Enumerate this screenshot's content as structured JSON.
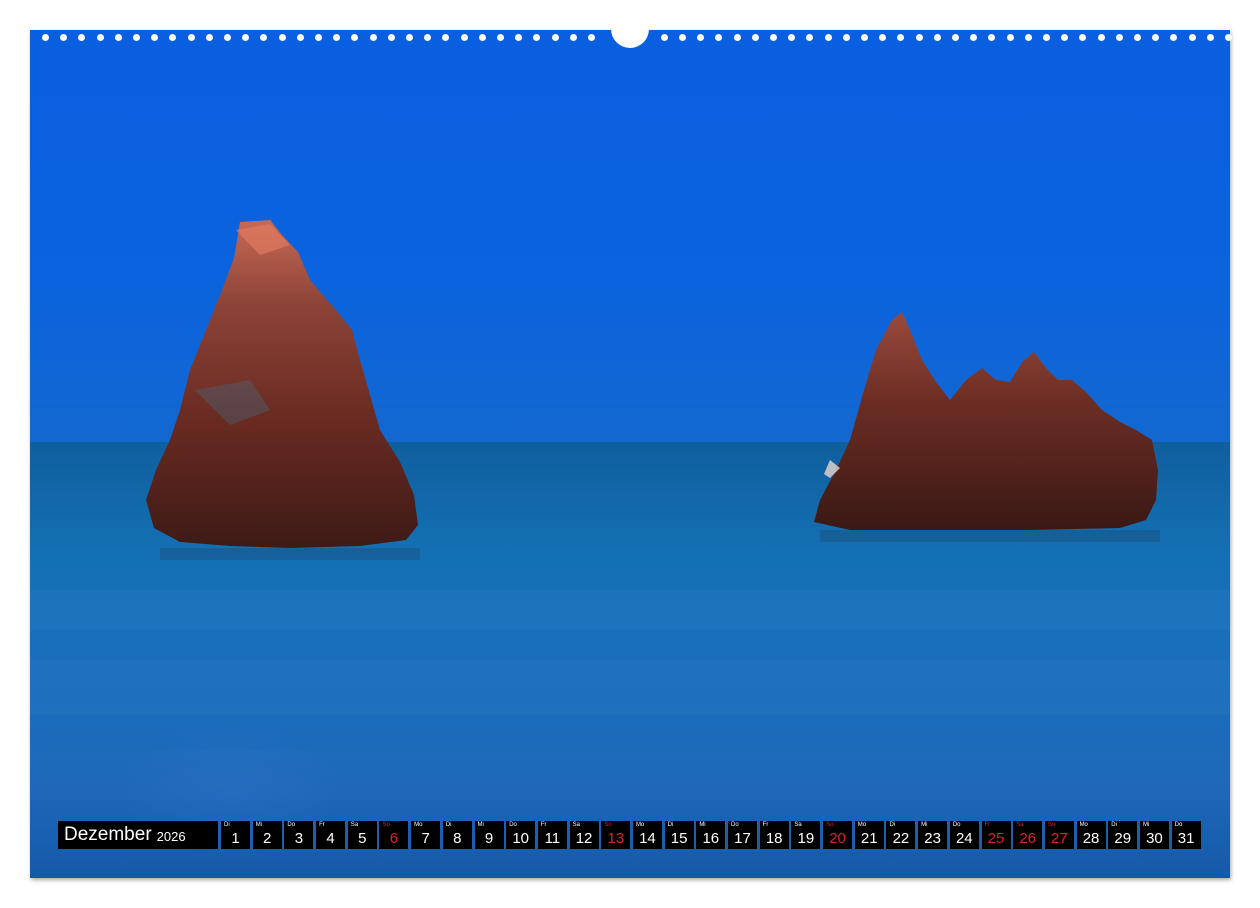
{
  "calendar": {
    "month": "Dezember",
    "year": "2026",
    "days": [
      {
        "dow": "Di",
        "num": "1",
        "red": false
      },
      {
        "dow": "Mi",
        "num": "2",
        "red": false
      },
      {
        "dow": "Do",
        "num": "3",
        "red": false
      },
      {
        "dow": "Fr",
        "num": "4",
        "red": false
      },
      {
        "dow": "Sa",
        "num": "5",
        "red": false
      },
      {
        "dow": "So",
        "num": "6",
        "red": true
      },
      {
        "dow": "Mo",
        "num": "7",
        "red": false
      },
      {
        "dow": "Di",
        "num": "8",
        "red": false
      },
      {
        "dow": "Mi",
        "num": "9",
        "red": false
      },
      {
        "dow": "Do",
        "num": "10",
        "red": false
      },
      {
        "dow": "Fr",
        "num": "11",
        "red": false
      },
      {
        "dow": "Sa",
        "num": "12",
        "red": false
      },
      {
        "dow": "So",
        "num": "13",
        "red": true
      },
      {
        "dow": "Mo",
        "num": "14",
        "red": false
      },
      {
        "dow": "Di",
        "num": "15",
        "red": false
      },
      {
        "dow": "Mi",
        "num": "16",
        "red": false
      },
      {
        "dow": "Do",
        "num": "17",
        "red": false
      },
      {
        "dow": "Fr",
        "num": "18",
        "red": false
      },
      {
        "dow": "Sa",
        "num": "19",
        "red": false
      },
      {
        "dow": "So",
        "num": "20",
        "red": true
      },
      {
        "dow": "Mo",
        "num": "21",
        "red": false
      },
      {
        "dow": "Di",
        "num": "22",
        "red": false
      },
      {
        "dow": "Mi",
        "num": "23",
        "red": false
      },
      {
        "dow": "Do",
        "num": "24",
        "red": false
      },
      {
        "dow": "Fr",
        "num": "25",
        "red": true
      },
      {
        "dow": "Sa",
        "num": "26",
        "red": true
      },
      {
        "dow": "So",
        "num": "27",
        "red": true
      },
      {
        "dow": "Mo",
        "num": "28",
        "red": false
      },
      {
        "dow": "Di",
        "num": "29",
        "red": false
      },
      {
        "dow": "Mi",
        "num": "30",
        "red": false
      },
      {
        "dow": "Do",
        "num": "31",
        "red": false
      }
    ]
  },
  "colors": {
    "sky": "#0a5fd8",
    "sea": "#1668b0",
    "rock": "#6b2b22",
    "holiday_red": "#e0202a"
  }
}
